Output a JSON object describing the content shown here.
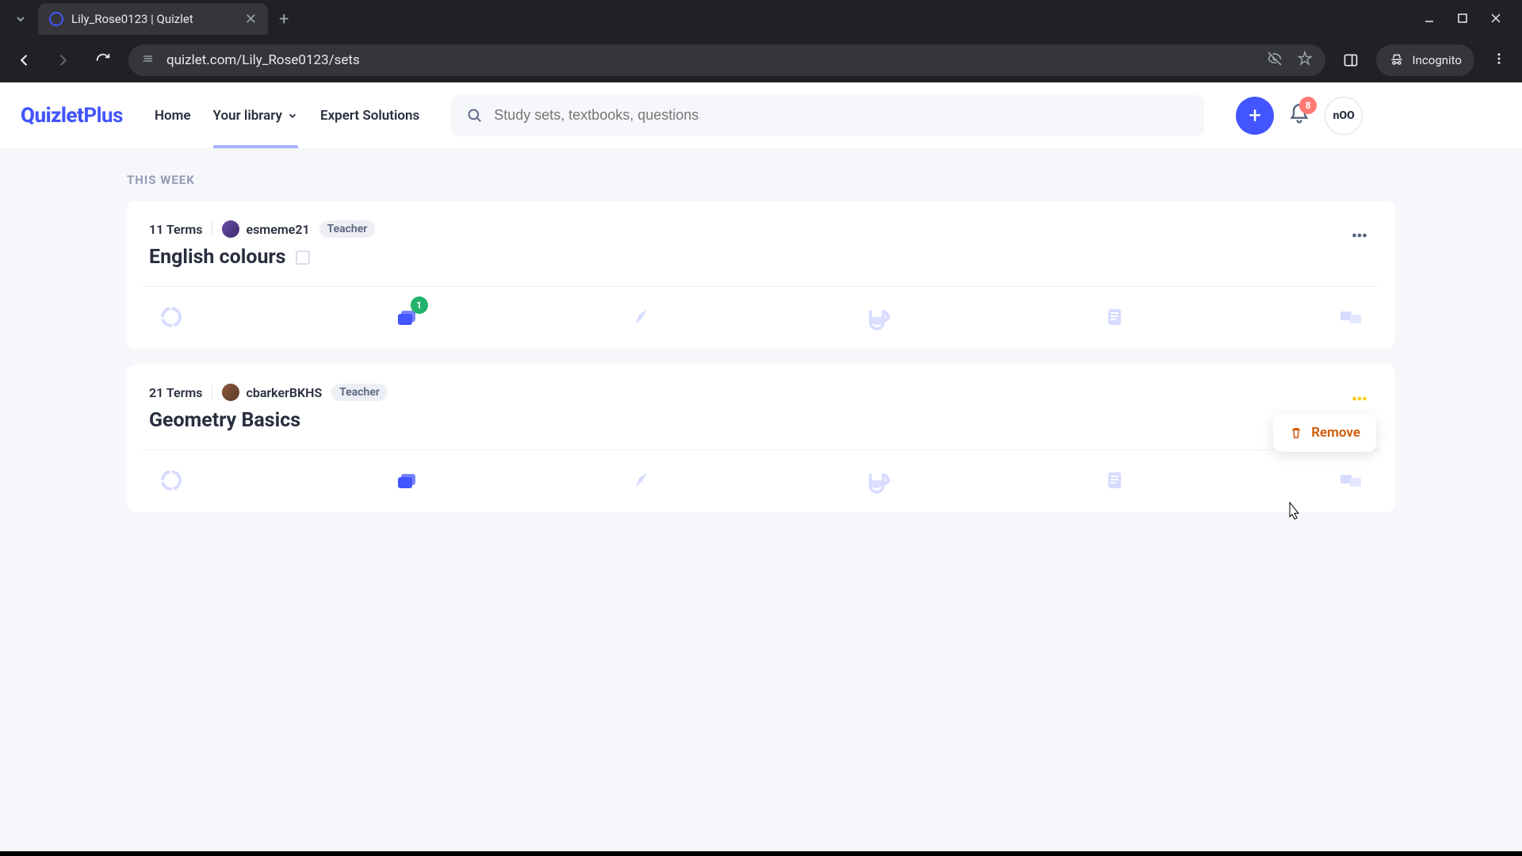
{
  "browser": {
    "tab_title": "Lily_Rose0123 | Quizlet",
    "url": "quizlet.com/Lily_Rose0123/sets",
    "incognito_label": "Incognito"
  },
  "header": {
    "logo_main": "Quizlet",
    "logo_suffix": "Plus",
    "nav": {
      "home": "Home",
      "library": "Your library",
      "expert": "Expert Solutions"
    },
    "search_placeholder": "Study sets, textbooks, questions",
    "notification_count": "8",
    "avatar_text": "nOO"
  },
  "section_label": "THIS WEEK",
  "sets": [
    {
      "term_count": "11 Terms",
      "author": "esmeme21",
      "role": "Teacher",
      "title": "English colours",
      "has_title_icon": true,
      "badge": "1",
      "more_active": false,
      "show_remove": false
    },
    {
      "term_count": "21 Terms",
      "author": "cbarkerBKHS",
      "role": "Teacher",
      "title": "Geometry Basics",
      "has_title_icon": false,
      "badge": null,
      "more_active": true,
      "show_remove": true
    }
  ],
  "remove_label": "Remove"
}
